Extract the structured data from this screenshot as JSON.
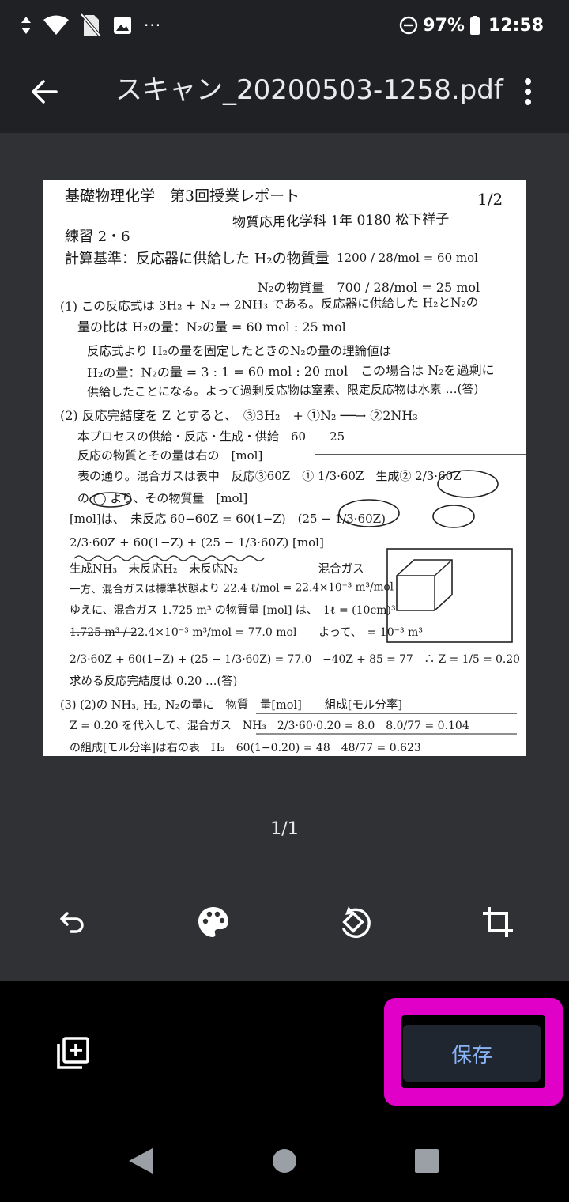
{
  "status_bar": {
    "battery": "97%",
    "time": "12:58",
    "more": "···"
  },
  "app_bar": {
    "title": "スキャン_20200503-1258.pdf"
  },
  "document": {
    "lines": [
      "基礎物理化学　第3回授業レポート",
      "1/2",
      "物質応用化学科 1年 0180 松下祥子",
      "練習 2・6",
      "計算基準：反応器に供給した H₂の物質量",
      "1200 / 28/mol = 60 mol",
      "N₂の物質量　700 / 28/mol = 25 mol",
      "(1) この反応式は 3H₂ + N₂ → 2NH₃ である。反応器に供給した H₂とN₂の",
      "量の比は H₂の量：N₂の量 = 60 mol : 25 mol",
      "反応式より H₂の量を固定したときのN₂の量の理論値は",
      "H₂の量：N₂の量 = 3 : 1 = 60 mol : 20 mol　この場合は N₂を過剰に",
      "供給したことになる。よって過剰反応物は窒素、限定反応物は水素 …(答)",
      "(2) 反応完結度を Z とすると、　③3H₂　+ ①N₂ ──→ ②2NH₃",
      "本プロセスの供給・反応・生成・供給　60　　25",
      "反応の物質とその量は右の　[mol]",
      "表の通り。混合ガスは表中　反応③60Z　① 1/3·60Z　生成② 2/3·60Z",
      "の ◯ より、その物質量　[mol]",
      "[mol]は、　未反応 60−60Z = 60(1−Z)　(25 − 1/3·60Z)",
      "2/3·60Z + 60(1−Z) + (25 − 1/3·60Z) [mol]",
      "生成NH₃　未反応H₂　未反応N₂　　　　　　　混合ガス",
      "一方、混合ガスは標準状態より 22.4 ℓ/mol = 22.4×10⁻³ m³/mol",
      "ゆえに、混合ガス 1.725 m³ の物質量 [mol] は、　1ℓ = (10cm)³",
      "1.725 m³ / 22.4×10⁻³ m³/mol = 77.0 mol　　よって、　= 10⁻³ m³",
      "2/3·60Z + 60(1−Z) + (25 − 1/3·60Z) = 77.0　−40Z + 85 = 77　∴ Z = 1/5 = 0.20",
      "求める反応完結度は 0.20 …(答)",
      "(3) (2)の NH₃, H₂, N₂の量に　物質　量[mol]　　組成[モル分率]",
      "Z = 0.20 を代入して、混合ガス　NH₃　2/3·60·0.20 = 8.0　8.0/77 = 0.104",
      "の組成[モル分率]は右の表　H₂　60(1−0.20) = 48　48/77 = 0.623"
    ]
  },
  "page_counter": "1/1",
  "tools": {
    "undo": "undo",
    "color": "color-filter",
    "rotate": "rotate",
    "crop": "crop"
  },
  "actions": {
    "save_label": "保存"
  },
  "colors": {
    "bar_bg": "#202124",
    "preview_bg": "#303134",
    "save_text": "#8ab4f8",
    "highlight": "#e000c8"
  }
}
